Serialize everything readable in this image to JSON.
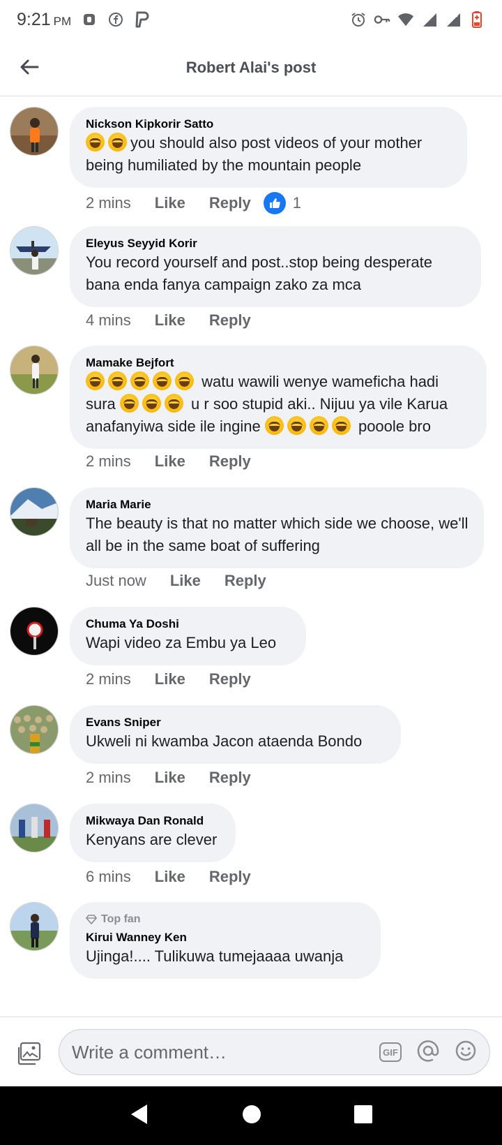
{
  "status_bar": {
    "time": "9:21",
    "ampm": "PM"
  },
  "header": {
    "title": "Robert Alai's post"
  },
  "comments": [
    {
      "author": "Nickson Kipkorir Satto",
      "emoji_prefix": 2,
      "text": "you should also post videos of your mother being humiliated by the mountain people",
      "time": "2 mins",
      "like_label": "Like",
      "reply_label": "Reply",
      "reaction_count": "1"
    },
    {
      "author": "Eleyus Seyyid Korir",
      "text": "You record yourself and post..stop being desperate bana enda fanya campaign zako za mca",
      "time": "4 mins",
      "like_label": "Like",
      "reply_label": "Reply"
    },
    {
      "author": "Mamake Bejfort",
      "text_part1": " watu wawili wenye wameficha hadi sura ",
      "text_part2": " u r soo stupid aki.. Nijuu ya vile Karua anafanyiwa side ile ingine ",
      "text_part3": " pooole bro",
      "time": "2 mins",
      "like_label": "Like",
      "reply_label": "Reply"
    },
    {
      "author": "Maria Marie",
      "text": "The beauty is that no matter which side we choose, we'll all be in the same boat of suffering",
      "time": "Just now",
      "like_label": "Like",
      "reply_label": "Reply"
    },
    {
      "author": "Chuma Ya Doshi",
      "text": "Wapi video za Embu ya Leo",
      "time": "2 mins",
      "like_label": "Like",
      "reply_label": "Reply"
    },
    {
      "author": "Evans Sniper",
      "text": "Ukweli ni kwamba Jacon ataenda Bondo",
      "time": "2 mins",
      "like_label": "Like",
      "reply_label": "Reply"
    },
    {
      "author": "Mikwaya Dan Ronald",
      "text": "Kenyans are clever",
      "time": "6 mins",
      "like_label": "Like",
      "reply_label": "Reply"
    },
    {
      "badge": "Top fan",
      "author": "Kirui Wanney Ken",
      "text": "Ujinga!.... Tulikuwa tumejaaaa uwanja"
    }
  ],
  "composer": {
    "placeholder": "Write a comment…",
    "gif_label": "GIF"
  },
  "colors": {
    "bubble": "#f0f2f5",
    "like_blue": "#1877f2",
    "meta_gray": "#65676b"
  }
}
